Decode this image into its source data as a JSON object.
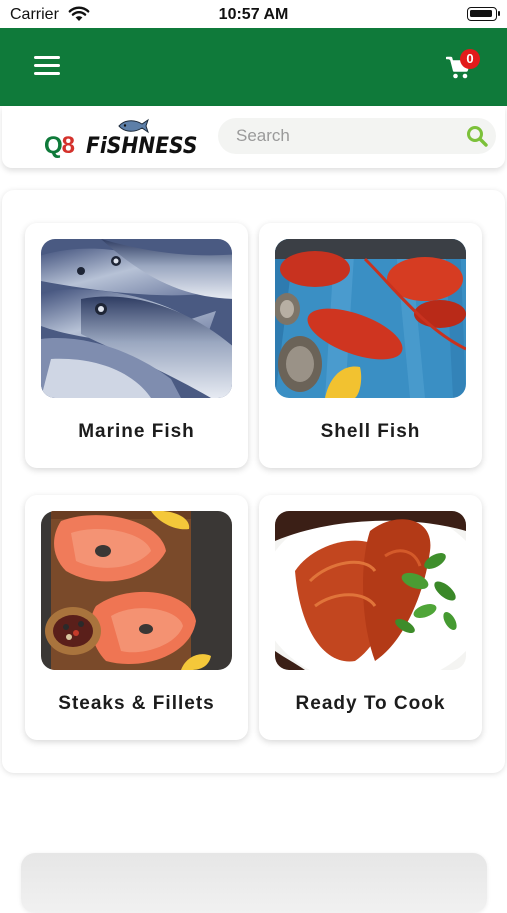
{
  "status_bar": {
    "carrier": "Carrier",
    "time": "10:57 AM"
  },
  "app_bar": {
    "background": "#0f7a3a",
    "menu_icon": "hamburger-menu-icon",
    "cart_icon": "shopping-cart-icon",
    "cart_count": "0"
  },
  "header": {
    "logo_prefix": "Q",
    "logo_digit": "8",
    "logo_word": "FiSHNESS",
    "search_placeholder": "Search",
    "search_icon": "search-icon",
    "accent": "#7cc13a"
  },
  "categories": [
    {
      "label": "Marine Fish"
    },
    {
      "label": "Shell Fish"
    },
    {
      "label": "Steaks & Fillets"
    },
    {
      "label": "Ready To Cook"
    }
  ]
}
